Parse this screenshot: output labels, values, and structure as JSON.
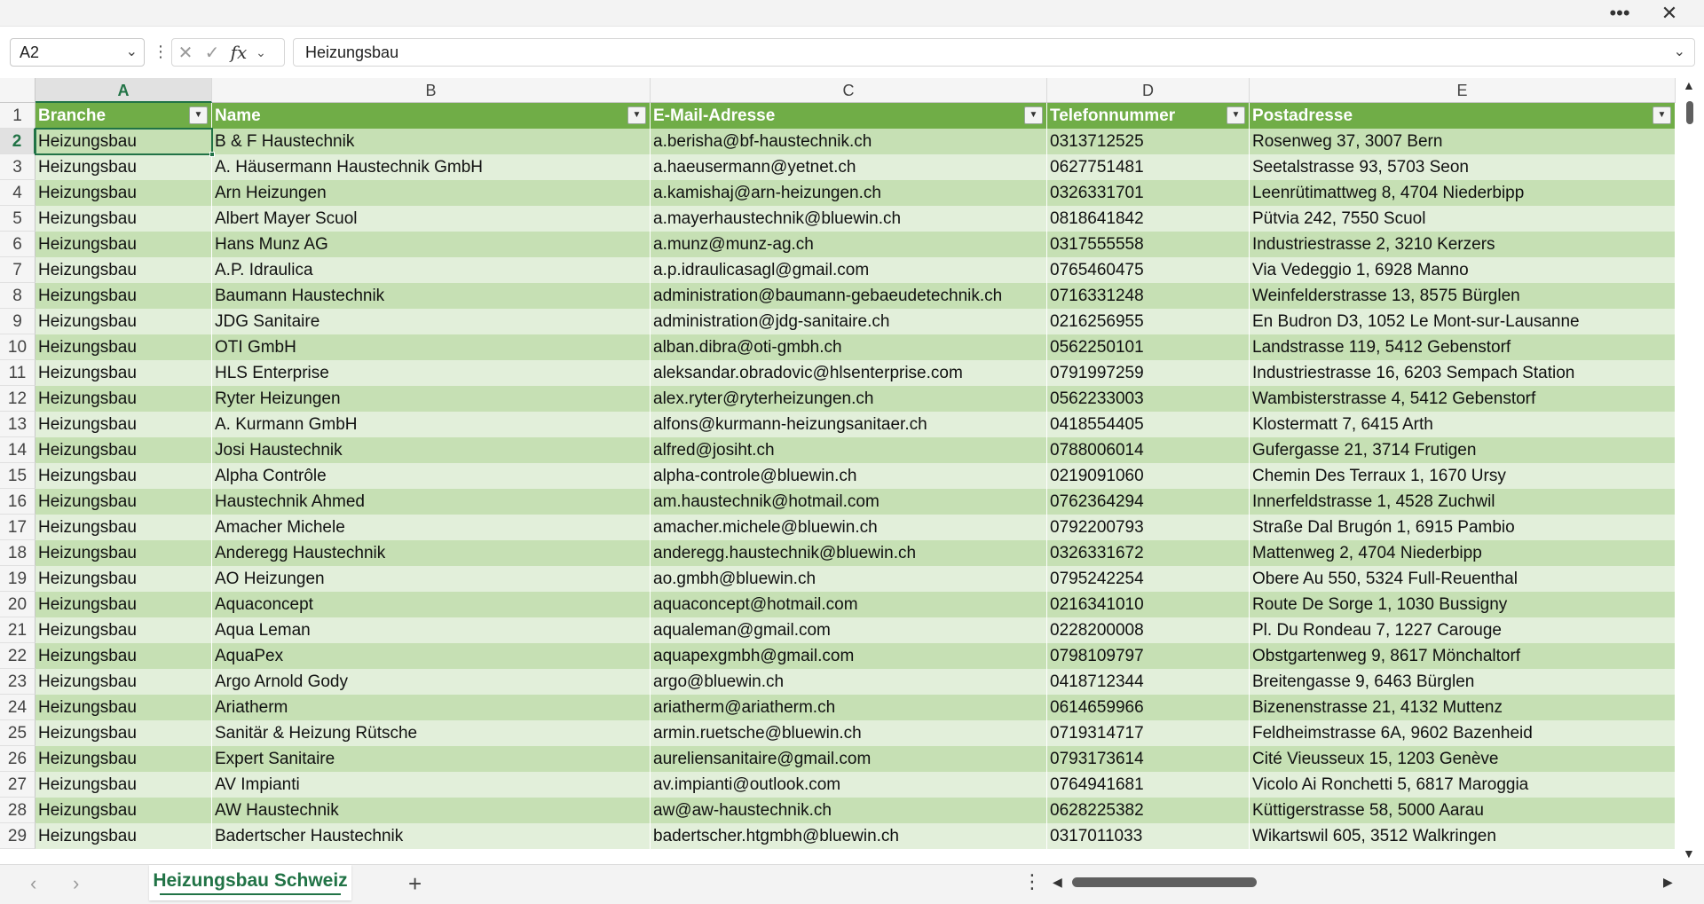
{
  "window": {
    "more_icon": "more-horizontal-icon",
    "more_label": "•••",
    "close_label": "✕"
  },
  "formula_bar": {
    "name_box": "A2",
    "cancel_label": "✕",
    "enter_label": "✓",
    "fx_label": "fx",
    "value": "Heizungsbau"
  },
  "columns": [
    {
      "letter": "A",
      "header": "Branche"
    },
    {
      "letter": "B",
      "header": "Name"
    },
    {
      "letter": "C",
      "header": "E-Mail-Adresse"
    },
    {
      "letter": "D",
      "header": "Telefonnummer"
    },
    {
      "letter": "E",
      "header": "Postadresse"
    }
  ],
  "header_row_number": "1",
  "rows": [
    {
      "num": "2",
      "cells": [
        "Heizungsbau",
        "B & F Haustechnik",
        "a.berisha@bf-haustechnik.ch",
        "0313712525",
        "Rosenweg 37, 3007 Bern"
      ]
    },
    {
      "num": "3",
      "cells": [
        "Heizungsbau",
        "A. Häusermann Haustechnik GmbH",
        "a.haeusermann@yetnet.ch",
        "0627751481",
        "Seetalstrasse 93, 5703 Seon"
      ]
    },
    {
      "num": "4",
      "cells": [
        "Heizungsbau",
        "Arn Heizungen",
        "a.kamishaj@arn-heizungen.ch",
        "0326331701",
        "Leenrütimattweg 8, 4704 Niederbipp"
      ]
    },
    {
      "num": "5",
      "cells": [
        "Heizungsbau",
        "Albert Mayer Scuol",
        "a.mayerhaustechnik@bluewin.ch",
        "0818641842",
        "Pütvia 242, 7550 Scuol"
      ]
    },
    {
      "num": "6",
      "cells": [
        "Heizungsbau",
        "Hans Munz AG",
        "a.munz@munz-ag.ch",
        "0317555558",
        "Industriestrasse 2, 3210 Kerzers"
      ]
    },
    {
      "num": "7",
      "cells": [
        "Heizungsbau",
        "A.P. Idraulica",
        "a.p.idraulicasagl@gmail.com",
        "0765460475",
        "Via Vedeggio 1, 6928 Manno"
      ]
    },
    {
      "num": "8",
      "cells": [
        "Heizungsbau",
        "Baumann Haustechnik",
        "administration@baumann-gebaeudetechnik.ch",
        "0716331248",
        "Weinfelderstrasse 13, 8575 Bürglen"
      ]
    },
    {
      "num": "9",
      "cells": [
        "Heizungsbau",
        "JDG Sanitaire",
        "administration@jdg-sanitaire.ch",
        "0216256955",
        "En Budron D3, 1052 Le Mont-sur-Lausanne"
      ]
    },
    {
      "num": "10",
      "cells": [
        "Heizungsbau",
        "OTI GmbH",
        "alban.dibra@oti-gmbh.ch",
        "0562250101",
        "Landstrasse 119, 5412 Gebenstorf"
      ]
    },
    {
      "num": "11",
      "cells": [
        "Heizungsbau",
        "HLS Enterprise",
        "aleksandar.obradovic@hlsenterprise.com",
        "0791997259",
        "Industriestrasse 16, 6203 Sempach Station"
      ]
    },
    {
      "num": "12",
      "cells": [
        "Heizungsbau",
        "Ryter Heizungen",
        "alex.ryter@ryterheizungen.ch",
        "0562233003",
        "Wambisterstrasse 4, 5412 Gebenstorf"
      ]
    },
    {
      "num": "13",
      "cells": [
        "Heizungsbau",
        "A. Kurmann GmbH",
        "alfons@kurmann-heizungsanitaer.ch",
        "0418554405",
        "Klostermatt 7, 6415 Arth"
      ]
    },
    {
      "num": "14",
      "cells": [
        "Heizungsbau",
        "Josi Haustechnik",
        "alfred@josiht.ch",
        "0788006014",
        "Gufergasse 21, 3714 Frutigen"
      ]
    },
    {
      "num": "15",
      "cells": [
        "Heizungsbau",
        "Alpha Contrôle",
        "alpha-controle@bluewin.ch",
        "0219091060",
        "Chemin Des Terraux 1, 1670 Ursy"
      ]
    },
    {
      "num": "16",
      "cells": [
        "Heizungsbau",
        "Haustechnik Ahmed",
        "am.haustechnik@hotmail.com",
        "0762364294",
        "Innerfeldstrasse 1, 4528 Zuchwil"
      ]
    },
    {
      "num": "17",
      "cells": [
        "Heizungsbau",
        "Amacher Michele",
        "amacher.michele@bluewin.ch",
        "0792200793",
        "Straße Dal Brugón 1, 6915 Pambio"
      ]
    },
    {
      "num": "18",
      "cells": [
        "Heizungsbau",
        "Anderegg Haustechnik",
        "anderegg.haustechnik@bluewin.ch",
        "0326331672",
        "Mattenweg 2, 4704 Niederbipp"
      ]
    },
    {
      "num": "19",
      "cells": [
        "Heizungsbau",
        "AO Heizungen",
        "ao.gmbh@bluewin.ch",
        "0795242254",
        "Obere Au 550, 5324 Full-Reuenthal"
      ]
    },
    {
      "num": "20",
      "cells": [
        "Heizungsbau",
        "Aquaconcept",
        "aquaconcept@hotmail.com",
        "0216341010",
        "Route De Sorge 1, 1030 Bussigny"
      ]
    },
    {
      "num": "21",
      "cells": [
        "Heizungsbau",
        "Aqua Leman",
        "aqualeman@gmail.com",
        "0228200008",
        "Pl. Du Rondeau 7, 1227 Carouge"
      ]
    },
    {
      "num": "22",
      "cells": [
        "Heizungsbau",
        "AquaPex",
        "aquapexgmbh@gmail.com",
        "0798109797",
        "Obstgartenweg 9, 8617 Mönchaltorf"
      ]
    },
    {
      "num": "23",
      "cells": [
        "Heizungsbau",
        "Argo Arnold Gody",
        "argo@bluewin.ch",
        "0418712344",
        "Breitengasse 9, 6463 Bürglen"
      ]
    },
    {
      "num": "24",
      "cells": [
        "Heizungsbau",
        "Ariatherm",
        "ariatherm@ariatherm.ch",
        "0614659966",
        "Bizenenstrasse 21, 4132 Muttenz"
      ]
    },
    {
      "num": "25",
      "cells": [
        "Heizungsbau",
        "Sanitär & Heizung Rütsche",
        "armin.ruetsche@bluewin.ch",
        "0719314717",
        "Feldheimstrasse 6A, 9602 Bazenheid"
      ]
    },
    {
      "num": "26",
      "cells": [
        "Heizungsbau",
        "Expert Sanitaire",
        "aureliensanitaire@gmail.com",
        "0793173614",
        "Cité Vieusseux 15, 1203 Genève"
      ]
    },
    {
      "num": "27",
      "cells": [
        "Heizungsbau",
        "AV Impianti",
        "av.impianti@outlook.com",
        "0764941681",
        "Vicolo Ai Ronchetti 5, 6817 Maroggia"
      ]
    },
    {
      "num": "28",
      "cells": [
        "Heizungsbau",
        "AW Haustechnik",
        "aw@aw-haustechnik.ch",
        "0628225382",
        "Küttigerstrasse 58, 5000 Aarau"
      ]
    },
    {
      "num": "29",
      "cells": [
        "Heizungsbau",
        "Badertscher Haustechnik",
        "badertscher.htgmbh@bluewin.ch",
        "0317011033",
        "Wikartswil 605, 3512 Walkringen"
      ]
    }
  ],
  "sheet_tabs": {
    "active": "Heizungsbau Schweiz",
    "add_label": "+",
    "prev_label": "‹",
    "next_label": "›",
    "options_label": "⋮"
  },
  "colors": {
    "header": "#70ad47",
    "band_dark": "#c6e0b4",
    "band_light": "#e2efda",
    "accent": "#217346"
  }
}
